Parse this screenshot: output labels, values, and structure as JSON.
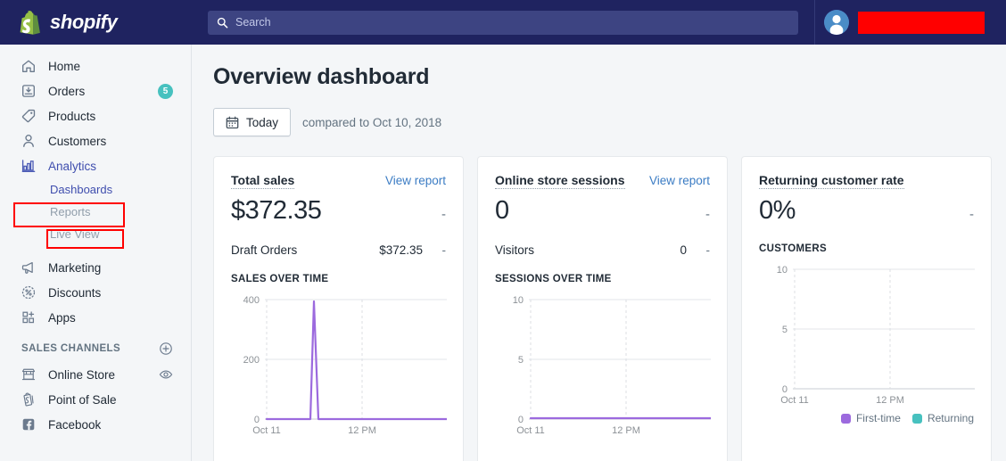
{
  "brand": {
    "name": "shopify",
    "logo_icon": "shopping-bag-icon",
    "logo_color": "#95bf46",
    "header_bg": "#1f2360"
  },
  "search": {
    "placeholder": "Search",
    "icon": "search-icon",
    "value": ""
  },
  "account": {
    "avatar_icon": "user-avatar-icon",
    "store_name_redacted": "",
    "redaction_color": "#ff0000"
  },
  "sidebar": {
    "items": [
      {
        "label": "Home",
        "icon": "home-icon",
        "badge": "",
        "active": false
      },
      {
        "label": "Orders",
        "icon": "orders-inbox-icon",
        "badge": "5",
        "active": false
      },
      {
        "label": "Products",
        "icon": "product-tag-icon",
        "badge": "",
        "active": false
      },
      {
        "label": "Customers",
        "icon": "customer-person-icon",
        "badge": "",
        "active": false
      },
      {
        "label": "Analytics",
        "icon": "analytics-bar-chart-icon",
        "badge": "",
        "active": true
      }
    ],
    "sub_items": [
      {
        "label": "Dashboards",
        "active": true
      },
      {
        "label": "Reports",
        "active": false
      },
      {
        "label": "Live View",
        "active": false
      }
    ],
    "items_after": [
      {
        "label": "Marketing",
        "icon": "marketing-megaphone-icon",
        "badge": "",
        "active": false
      },
      {
        "label": "Discounts",
        "icon": "discount-percent-icon",
        "badge": "",
        "active": false
      },
      {
        "label": "Apps",
        "icon": "apps-grid-plus-icon",
        "badge": "",
        "active": false
      }
    ],
    "sales_channels": {
      "title": "SALES CHANNELS",
      "add_icon": "plus-circle-icon",
      "channels": [
        {
          "label": "Online Store",
          "icon": "storefront-icon",
          "action_icon": "eye-icon"
        },
        {
          "label": "Point of Sale",
          "icon": "pos-shopify-bag-icon",
          "action_icon": ""
        },
        {
          "label": "Facebook",
          "icon": "facebook-icon",
          "action_icon": ""
        }
      ]
    },
    "highlight_boxes": [
      {
        "target": "Analytics",
        "color": "#ff0000"
      },
      {
        "target": "Dashboards",
        "color": "#ff0000"
      }
    ]
  },
  "main": {
    "page_title": "Overview dashboard",
    "date_button": {
      "label": "Today",
      "icon": "calendar-icon"
    },
    "compared_to": "compared to Oct 10, 2018"
  },
  "cards": [
    {
      "title": "Total sales",
      "view_report": "View report",
      "value": "$372.35",
      "delta": "-",
      "sub_name": "Draft Orders",
      "sub_value": "$372.35",
      "sub_delta": "-",
      "chart_label": "SALES OVER TIME",
      "has_legend": false
    },
    {
      "title": "Online store sessions",
      "view_report": "View report",
      "value": "0",
      "delta": "-",
      "sub_name": "Visitors",
      "sub_value": "0",
      "sub_delta": "-",
      "chart_label": "SESSIONS OVER TIME",
      "has_legend": false
    },
    {
      "title": "Returning customer rate",
      "view_report": "",
      "value": "0%",
      "delta": "-",
      "sub_name": "",
      "sub_value": "",
      "sub_delta": "",
      "chart_label": "CUSTOMERS",
      "has_legend": true,
      "legend": [
        {
          "label": "First-time",
          "color": "#9c6ade"
        },
        {
          "label": "Returning",
          "color": "#47c1bf"
        }
      ]
    }
  ],
  "chart_data": [
    {
      "type": "line",
      "title": "SALES OVER TIME",
      "xlabel": "",
      "ylabel": "",
      "ylim": [
        0,
        440
      ],
      "yticks": [
        0,
        200,
        400
      ],
      "ytick_labels": [
        "0",
        "200",
        "400"
      ],
      "xticks": [
        "Oct 11",
        "12 PM"
      ],
      "x": [
        "12 AM",
        "1 AM",
        "2 AM",
        "3 AM",
        "4 AM",
        "5 AM",
        "6 AM",
        "7 AM",
        "8 AM",
        "9 AM",
        "10 AM",
        "11 AM",
        "12 PM",
        "1 PM",
        "2 PM",
        "3 PM",
        "4 PM",
        "5 PM",
        "6 PM",
        "7 PM",
        "8 PM",
        "9 PM",
        "10 PM",
        "11 PM"
      ],
      "series": [
        {
          "name": "Total sales",
          "color": "#9c6ade",
          "values": [
            0,
            0,
            0,
            0,
            0,
            372.35,
            0,
            0,
            0,
            0,
            0,
            0,
            0,
            0,
            0,
            0,
            0,
            0,
            0,
            0,
            0,
            0,
            0,
            0
          ]
        }
      ],
      "grid": true,
      "legend_position": "none"
    },
    {
      "type": "line",
      "title": "SESSIONS OVER TIME",
      "xlabel": "",
      "ylabel": "",
      "ylim": [
        0,
        10
      ],
      "yticks": [
        0,
        5,
        10
      ],
      "ytick_labels": [
        "0",
        "5",
        "10"
      ],
      "xticks": [
        "Oct 11",
        "12 PM"
      ],
      "x": [
        "12 AM",
        "1 AM",
        "2 AM",
        "3 AM",
        "4 AM",
        "5 AM",
        "6 AM",
        "7 AM",
        "8 AM",
        "9 AM",
        "10 AM",
        "11 AM",
        "12 PM",
        "1 PM",
        "2 PM",
        "3 PM",
        "4 PM",
        "5 PM",
        "6 PM",
        "7 PM",
        "8 PM",
        "9 PM",
        "10 PM",
        "11 PM"
      ],
      "series": [
        {
          "name": "Sessions",
          "color": "#9c6ade",
          "values": [
            0,
            0,
            0,
            0,
            0,
            0,
            0,
            0,
            0,
            0,
            0,
            0,
            0,
            0,
            0,
            0,
            0,
            0,
            0,
            0,
            0,
            0,
            0,
            0
          ]
        }
      ],
      "grid": true,
      "legend_position": "none"
    },
    {
      "type": "line",
      "title": "CUSTOMERS",
      "xlabel": "",
      "ylabel": "",
      "ylim": [
        0,
        10
      ],
      "yticks": [
        0,
        5,
        10
      ],
      "ytick_labels": [
        "0",
        "5",
        "10"
      ],
      "xticks": [
        "Oct 11",
        "12 PM"
      ],
      "x": [
        "12 AM",
        "1 AM",
        "2 AM",
        "3 AM",
        "4 AM",
        "5 AM",
        "6 AM",
        "7 AM",
        "8 AM",
        "9 AM",
        "10 AM",
        "11 AM",
        "12 PM",
        "1 PM",
        "2 PM",
        "3 PM",
        "4 PM",
        "5 PM",
        "6 PM",
        "7 PM",
        "8 PM",
        "9 PM",
        "10 PM",
        "11 PM"
      ],
      "series": [
        {
          "name": "First-time",
          "color": "#9c6ade",
          "values": [
            0,
            0,
            0,
            0,
            0,
            0,
            0,
            0,
            0,
            0,
            0,
            0,
            0,
            0,
            0,
            0,
            0,
            0,
            0,
            0,
            0,
            0,
            0,
            0
          ]
        },
        {
          "name": "Returning",
          "color": "#47c1bf",
          "values": [
            0,
            0,
            0,
            0,
            0,
            0,
            0,
            0,
            0,
            0,
            0,
            0,
            0,
            0,
            0,
            0,
            0,
            0,
            0,
            0,
            0,
            0,
            0,
            0
          ]
        }
      ],
      "grid": true,
      "legend_position": "bottom-right"
    }
  ]
}
